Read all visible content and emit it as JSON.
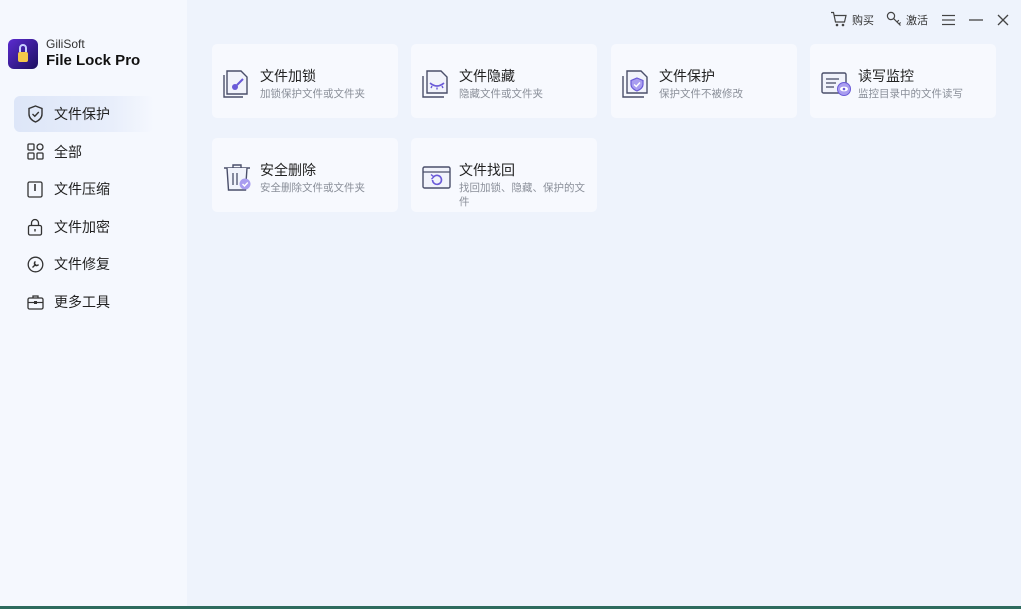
{
  "app": {
    "brand": "GiliSoft",
    "product": "File Lock Pro"
  },
  "topbar": {
    "buy_label": "购买",
    "activate_label": "激活"
  },
  "sidebar": {
    "items": [
      {
        "label": "文件保护",
        "icon": "shield-icon",
        "active": true
      },
      {
        "label": "全部",
        "icon": "grid-icon",
        "active": false
      },
      {
        "label": "文件压缩",
        "icon": "compress-icon",
        "active": false
      },
      {
        "label": "文件加密",
        "icon": "lock-icon",
        "active": false
      },
      {
        "label": "文件修复",
        "icon": "repair-icon",
        "active": false
      },
      {
        "label": "更多工具",
        "icon": "toolbox-icon",
        "active": false
      }
    ]
  },
  "cards": [
    {
      "title": "文件加锁",
      "desc": "加锁保护文件或文件夹",
      "icon": "file-lock-icon"
    },
    {
      "title": "文件隐藏",
      "desc": "隐藏文件或文件夹",
      "icon": "file-hide-icon"
    },
    {
      "title": "文件保护",
      "desc": "保护文件不被修改",
      "icon": "file-protect-icon"
    },
    {
      "title": "读写监控",
      "desc": "监控目录中的文件读写",
      "icon": "monitor-icon"
    },
    {
      "title": "安全删除",
      "desc": "安全删除文件或文件夹",
      "icon": "trash-icon"
    },
    {
      "title": "文件找回",
      "desc": "找回加锁、隐藏、保护的文件",
      "icon": "recover-icon"
    }
  ],
  "colors": {
    "accent": "#6a5ad8",
    "icon_stroke": "#4a4f6a",
    "active_bg": "#dde6f8"
  }
}
